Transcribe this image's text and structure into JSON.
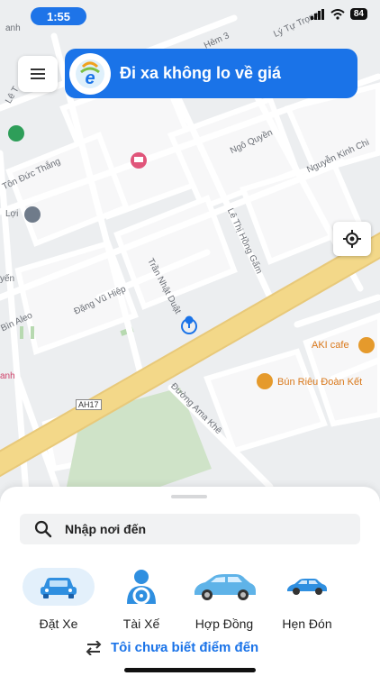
{
  "status_bar": {
    "time": "1:55",
    "battery": "84"
  },
  "banner": {
    "text": "Đi xa không lo về giá"
  },
  "map": {
    "labels": {
      "hem": "Hẻm 3",
      "ly_tu_trong": "Lý Tự Trọng",
      "le": "Lê T",
      "anh": "anh",
      "ngo_quyen": "Ngô Quyền",
      "ton_duc_thang": "Tôn Đức Thắng",
      "nguyen_kinh_chi": "Nguyễn Kinh Chi",
      "loi": "Lợi",
      "le_thi_hong_gam": "Lê Thị Hồng Gấm",
      "dang_vu_hiep": "Đặng Vũ Hiệp",
      "tran_nhat_duat": "Trần Nhật Duật",
      "yen": "yến",
      "bin_aleo": "Bìn Aleo",
      "anh2": "anh",
      "ah17": "AH17",
      "duong_ama_khe": "Đường Ama Khê"
    },
    "pois": {
      "aki_cafe": "AKI cafe",
      "bun_rieu": "Bún Riêu Đoàn Kết"
    }
  },
  "search": {
    "placeholder": "Nhập nơi đến"
  },
  "services": [
    {
      "label": "Đặt Xe"
    },
    {
      "label": "Tài Xế"
    },
    {
      "label": "Hợp Đồng"
    },
    {
      "label": "Hẹn Đón"
    }
  ],
  "unknown_destination": {
    "label": "Tôi chưa biết điểm đến"
  },
  "colors": {
    "accent": "#1a73e8",
    "highway": "#f3d889",
    "park": "#cfe3c8",
    "poi": "#d9781a"
  }
}
